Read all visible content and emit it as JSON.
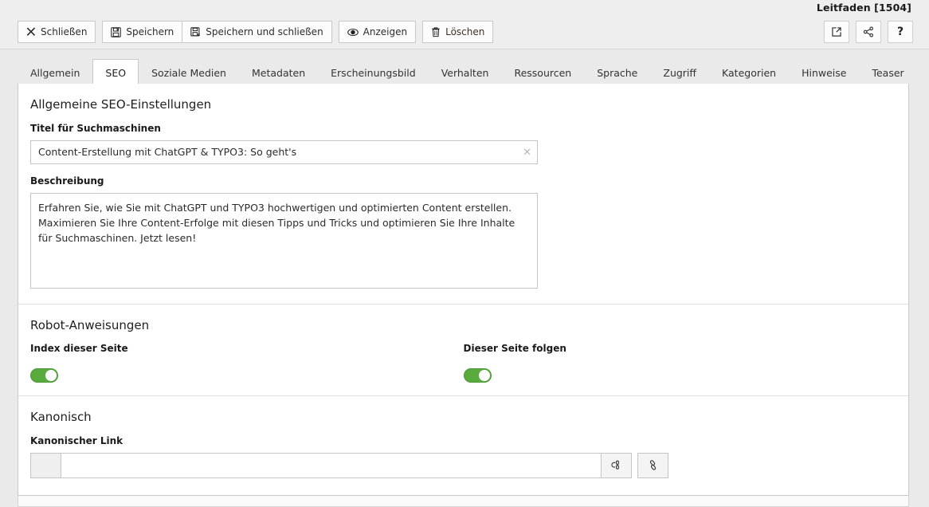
{
  "header": {
    "record_title": "Leitfaden [1504]",
    "buttons": [
      {
        "name": "close",
        "label": "Schließen",
        "icon": "close-x-icon"
      },
      {
        "name": "save",
        "label": "Speichern",
        "icon": "floppy-save-icon"
      },
      {
        "name": "save-and-close",
        "label": "Speichern und schließen",
        "icon": "floppy-save-close-icon"
      },
      {
        "name": "view",
        "label": "Anzeigen",
        "icon": "eye-view-icon"
      },
      {
        "name": "delete",
        "label": "Löschen",
        "icon": "trash-delete-icon"
      }
    ],
    "icon_buttons": [
      {
        "name": "open-in-new-window",
        "icon": "open-in-new-icon",
        "glyph": ""
      },
      {
        "name": "share-record",
        "icon": "share-icon",
        "glyph": ""
      },
      {
        "name": "help",
        "icon": "question-mark-icon",
        "glyph": "?"
      }
    ]
  },
  "tabs": [
    {
      "label": "Allgemein",
      "active": false
    },
    {
      "label": "SEO",
      "active": true
    },
    {
      "label": "Soziale Medien",
      "active": false
    },
    {
      "label": "Metadaten",
      "active": false
    },
    {
      "label": "Erscheinungsbild",
      "active": false
    },
    {
      "label": "Verhalten",
      "active": false
    },
    {
      "label": "Ressourcen",
      "active": false
    },
    {
      "label": "Sprache",
      "active": false
    },
    {
      "label": "Zugriff",
      "active": false
    },
    {
      "label": "Kategorien",
      "active": false
    },
    {
      "label": "Hinweise",
      "active": false
    },
    {
      "label": "Teaser",
      "active": false
    }
  ],
  "seo_section": {
    "title": "Allgemeine SEO-Einstellungen",
    "title_field": {
      "label": "Titel für Suchmaschinen",
      "value": "Content-Erstellung mit ChatGPT & TYPO3: So geht's",
      "placeholder": "",
      "clear_glyph": "×"
    },
    "description_field": {
      "label": "Beschreibung",
      "value": "Erfahren Sie, wie Sie mit ChatGPT und TYPO3 hochwertigen und optimierten Content erstellen. Maximieren Sie Ihre Content-Erfolge mit diesen Tipps und Tricks und optimieren Sie Ihre Inhalte für Suchmaschinen. Jetzt lesen!",
      "placeholder": ""
    }
  },
  "robots_section": {
    "title": "Robot-Anweisungen",
    "index_label": "Index dieser Seite",
    "index_on": true,
    "follow_label": "Dieser Seite folgen",
    "follow_on": true
  },
  "canonical_section": {
    "title": "Kanonisch",
    "link_label": "Kanonischer Link",
    "link_value": "",
    "link_placeholder": "",
    "buttons": [
      {
        "name": "link-browser-button",
        "icon": "link-browse-icon"
      },
      {
        "name": "link-chain-button",
        "icon": "chain-link-icon"
      }
    ]
  },
  "colors": {
    "toggle_on": "#5aab3e",
    "panel_bg": "#ffffff",
    "chrome_bg": "#eeeeee"
  }
}
